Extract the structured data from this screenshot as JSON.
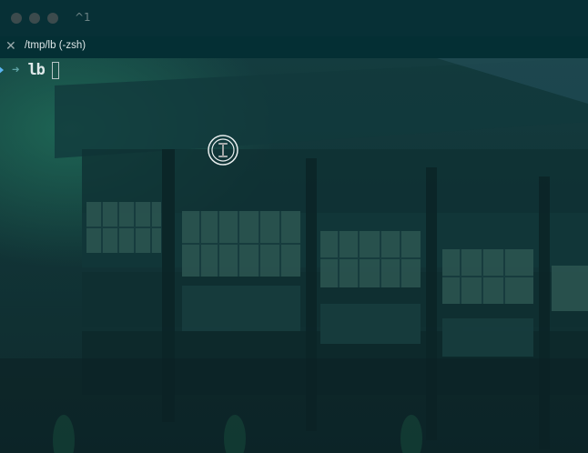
{
  "window": {
    "shortcut": "^1",
    "traffic_lights": [
      "close",
      "minimize",
      "zoom"
    ]
  },
  "tab": {
    "close_icon": "✕",
    "title": "/tmp/lb (-zsh)"
  },
  "terminal": {
    "prompt_arrow": "➜",
    "cwd": "lb"
  },
  "colors": {
    "titlebar": "#073036",
    "tabbar": "#042f34",
    "prompt_accent": "#5bb4f0",
    "text": "#dfe9ea"
  },
  "pointer": "ibeam-cursor-icon"
}
